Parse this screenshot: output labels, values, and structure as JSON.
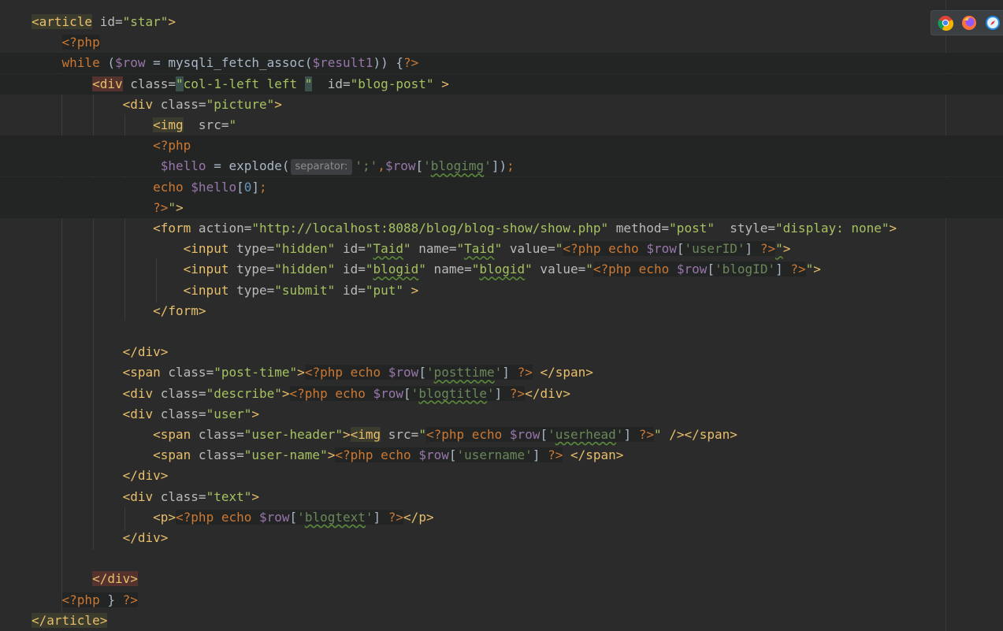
{
  "code_lines": [
    {
      "indent": "",
      "tokens": [
        [
          "tag tagbox",
          "<article"
        ],
        [
          "attr",
          " id="
        ],
        [
          "str",
          "\"star\""
        ],
        [
          "tag",
          ">"
        ]
      ]
    },
    {
      "indent": "    ",
      "tokens": [
        [
          "php phpblk",
          "<?php"
        ]
      ]
    },
    {
      "indent": "    ",
      "tokens": [
        [
          "php",
          "while"
        ],
        [
          "plain",
          " ("
        ],
        [
          "var",
          "$row"
        ],
        [
          "plain",
          " = "
        ],
        [
          "fn",
          "mysqli_fetch_assoc"
        ],
        [
          "plain",
          "("
        ],
        [
          "var",
          "$result1"
        ],
        [
          "plain",
          ")) {"
        ],
        [
          "php",
          "?>"
        ]
      ]
    },
    {
      "indent": "        ",
      "tokens": [
        [
          "tag errbox",
          "<div"
        ],
        [
          "attr",
          " class="
        ],
        [
          "str matchbox",
          "\""
        ],
        [
          "str",
          "col-1-left left "
        ],
        [
          "str matchbox",
          "\""
        ],
        [
          "attr",
          "  id="
        ],
        [
          "str",
          "\"blog-post\""
        ],
        [
          "tag",
          " >"
        ]
      ]
    },
    {
      "indent": "            ",
      "tokens": [
        [
          "tag",
          "<div"
        ],
        [
          "attr",
          " class="
        ],
        [
          "str",
          "\"picture\""
        ],
        [
          "tag",
          ">"
        ]
      ]
    },
    {
      "indent": "                ",
      "tokens": [
        [
          "tag tagbox",
          "<img"
        ],
        [
          "attr",
          "  src="
        ],
        [
          "str",
          "\""
        ]
      ]
    },
    {
      "indent": "                ",
      "tokens": [
        [
          "php",
          "<?php"
        ]
      ]
    },
    {
      "indent": "                 ",
      "tokens": [
        [
          "var",
          "$hello"
        ],
        [
          "plain",
          " = "
        ],
        [
          "fn",
          "explode("
        ],
        [
          "hint",
          "separator:"
        ],
        [
          "key",
          "';'"
        ],
        [
          "php",
          ","
        ],
        [
          "var",
          "$row"
        ],
        [
          "plain",
          "["
        ],
        [
          "key",
          "'"
        ],
        [
          "key wavy",
          "blogimg"
        ],
        [
          "key",
          "'"
        ],
        [
          "plain",
          "])"
        ],
        [
          "php",
          ";"
        ]
      ]
    },
    {
      "indent": "                ",
      "tokens": [
        [
          "php",
          "echo "
        ],
        [
          "var",
          "$hello"
        ],
        [
          "plain",
          "["
        ],
        [
          "num",
          "0"
        ],
        [
          "plain",
          "]"
        ],
        [
          "php",
          ";"
        ]
      ]
    },
    {
      "indent": "                ",
      "tokens": [
        [
          "php",
          "?>"
        ],
        [
          "str",
          "\""
        ],
        [
          "tag",
          ">"
        ]
      ]
    },
    {
      "indent": "                ",
      "tokens": [
        [
          "tag",
          "<form"
        ],
        [
          "attr",
          " action="
        ],
        [
          "str",
          "\"http://localhost:8088/blog/blog-show/show.php\""
        ],
        [
          "attr",
          " method="
        ],
        [
          "str",
          "\"post\""
        ],
        [
          "attr",
          "  style="
        ],
        [
          "str",
          "\"display: none\""
        ],
        [
          "tag",
          ">"
        ]
      ]
    },
    {
      "indent": "                    ",
      "tokens": [
        [
          "tag",
          "<input"
        ],
        [
          "attr",
          " type="
        ],
        [
          "str",
          "\"hidden\""
        ],
        [
          "attr",
          " id="
        ],
        [
          "str",
          "\""
        ],
        [
          "str wavy",
          "Taid"
        ],
        [
          "str",
          "\""
        ],
        [
          "attr",
          " name="
        ],
        [
          "str",
          "\""
        ],
        [
          "str wavy",
          "Taid"
        ],
        [
          "str",
          "\""
        ],
        [
          "attr",
          " value="
        ],
        [
          "str",
          "\""
        ],
        [
          "php phpblk",
          "<?php echo "
        ],
        [
          "var phpblk",
          "$row"
        ],
        [
          "plain phpblk",
          "["
        ],
        [
          "key phpblk",
          "'userID'"
        ],
        [
          "plain phpblk",
          "] "
        ],
        [
          "php phpblk",
          "?>"
        ],
        [
          "str wavy",
          "\""
        ],
        [
          "tag",
          ">"
        ]
      ]
    },
    {
      "indent": "                    ",
      "tokens": [
        [
          "tag",
          "<input"
        ],
        [
          "attr",
          " type="
        ],
        [
          "str",
          "\"hidden\""
        ],
        [
          "attr",
          " id="
        ],
        [
          "str",
          "\""
        ],
        [
          "str wavy",
          "blogid"
        ],
        [
          "str",
          "\""
        ],
        [
          "attr",
          " name="
        ],
        [
          "str",
          "\""
        ],
        [
          "str wavy",
          "blogid"
        ],
        [
          "str",
          "\""
        ],
        [
          "attr",
          " value="
        ],
        [
          "str",
          "\""
        ],
        [
          "php phpblk",
          "<?php echo "
        ],
        [
          "var phpblk",
          "$row"
        ],
        [
          "plain phpblk",
          "["
        ],
        [
          "key phpblk",
          "'blogID'"
        ],
        [
          "plain phpblk",
          "] "
        ],
        [
          "php phpblk",
          "?>"
        ],
        [
          "str",
          "\""
        ],
        [
          "tag",
          ">"
        ]
      ]
    },
    {
      "indent": "                    ",
      "tokens": [
        [
          "tag",
          "<input"
        ],
        [
          "attr",
          " type="
        ],
        [
          "str",
          "\"submit\""
        ],
        [
          "attr",
          " id="
        ],
        [
          "str",
          "\"put\""
        ],
        [
          "tag",
          " >"
        ]
      ]
    },
    {
      "indent": "                ",
      "tokens": [
        [
          "tag",
          "</form>"
        ]
      ]
    },
    {
      "indent": "",
      "tokens": []
    },
    {
      "indent": "            ",
      "tokens": [
        [
          "tag",
          "</div>"
        ]
      ]
    },
    {
      "indent": "            ",
      "tokens": [
        [
          "tag",
          "<span"
        ],
        [
          "attr",
          " class="
        ],
        [
          "str",
          "\"post-time\""
        ],
        [
          "tag",
          ">"
        ],
        [
          "php phpblk",
          "<?php echo "
        ],
        [
          "var phpblk",
          "$row"
        ],
        [
          "plain phpblk",
          "["
        ],
        [
          "key phpblk",
          "'"
        ],
        [
          "key phpblk wavy",
          "posttime"
        ],
        [
          "key phpblk",
          "'"
        ],
        [
          "plain phpblk",
          "] "
        ],
        [
          "php phpblk",
          "?>"
        ],
        [
          "tag",
          " </span>"
        ]
      ]
    },
    {
      "indent": "            ",
      "tokens": [
        [
          "tag",
          "<div"
        ],
        [
          "attr",
          " class="
        ],
        [
          "str",
          "\"describe\""
        ],
        [
          "tag",
          ">"
        ],
        [
          "php phpblk",
          "<?php echo "
        ],
        [
          "var phpblk",
          "$row"
        ],
        [
          "plain phpblk",
          "["
        ],
        [
          "key phpblk",
          "'"
        ],
        [
          "key phpblk wavy",
          "blogtitle"
        ],
        [
          "key phpblk",
          "'"
        ],
        [
          "plain phpblk",
          "] "
        ],
        [
          "php phpblk",
          "?>"
        ],
        [
          "tag",
          "</div>"
        ]
      ]
    },
    {
      "indent": "            ",
      "tokens": [
        [
          "tag",
          "<div"
        ],
        [
          "attr",
          " class="
        ],
        [
          "str",
          "\"user\""
        ],
        [
          "tag",
          ">"
        ]
      ]
    },
    {
      "indent": "                ",
      "tokens": [
        [
          "tag",
          "<span"
        ],
        [
          "attr",
          " class="
        ],
        [
          "str",
          "\"user-header\""
        ],
        [
          "tag",
          ">"
        ],
        [
          "tag tagbox",
          "<img"
        ],
        [
          "attr",
          " src="
        ],
        [
          "str",
          "\""
        ],
        [
          "php phpblk",
          "<?php echo "
        ],
        [
          "var phpblk",
          "$row"
        ],
        [
          "plain phpblk",
          "["
        ],
        [
          "key phpblk",
          "'"
        ],
        [
          "key phpblk wavy",
          "userhead"
        ],
        [
          "key phpblk",
          "'"
        ],
        [
          "plain phpblk",
          "] "
        ],
        [
          "php phpblk",
          "?>"
        ],
        [
          "str",
          "\""
        ],
        [
          "tag",
          " /></span>"
        ]
      ]
    },
    {
      "indent": "                ",
      "tokens": [
        [
          "tag",
          "<span"
        ],
        [
          "attr",
          " class="
        ],
        [
          "str",
          "\"user-name\""
        ],
        [
          "tag",
          ">"
        ],
        [
          "php phpblk",
          "<?php echo "
        ],
        [
          "var phpblk",
          "$row"
        ],
        [
          "plain phpblk",
          "["
        ],
        [
          "key phpblk",
          "'username'"
        ],
        [
          "plain phpblk",
          "] "
        ],
        [
          "php phpblk",
          "?>"
        ],
        [
          "tag",
          " </span>"
        ]
      ]
    },
    {
      "indent": "            ",
      "tokens": [
        [
          "tag",
          "</div>"
        ]
      ]
    },
    {
      "indent": "            ",
      "tokens": [
        [
          "tag",
          "<div"
        ],
        [
          "attr",
          " class="
        ],
        [
          "str",
          "\"text\""
        ],
        [
          "tag",
          ">"
        ]
      ]
    },
    {
      "indent": "                ",
      "tokens": [
        [
          "tag",
          "<p>"
        ],
        [
          "php phpblk",
          "<?php echo "
        ],
        [
          "var phpblk",
          "$row"
        ],
        [
          "plain phpblk",
          "["
        ],
        [
          "key phpblk",
          "'"
        ],
        [
          "key phpblk wavy",
          "blogtext"
        ],
        [
          "key phpblk",
          "'"
        ],
        [
          "plain phpblk",
          "] "
        ],
        [
          "php phpblk",
          "?>"
        ],
        [
          "tag",
          "</p>"
        ]
      ]
    },
    {
      "indent": "            ",
      "tokens": [
        [
          "tag",
          "</div>"
        ]
      ]
    },
    {
      "indent": "",
      "tokens": []
    },
    {
      "indent": "        ",
      "tokens": [
        [
          "tag errbox",
          "</div>"
        ]
      ]
    },
    {
      "indent": "    ",
      "tokens": [
        [
          "php phpblk",
          "<?php"
        ],
        [
          "plain phpblk",
          " } "
        ],
        [
          "php phpblk",
          "?>"
        ]
      ]
    },
    {
      "indent": "",
      "tokens": [
        [
          "tag tagbox",
          "</article>"
        ]
      ]
    }
  ],
  "highlighted_lines": [
    2,
    3,
    6,
    7,
    8,
    9
  ],
  "browser_icons": [
    "chrome-icon",
    "firefox-icon",
    "safari-icon"
  ]
}
